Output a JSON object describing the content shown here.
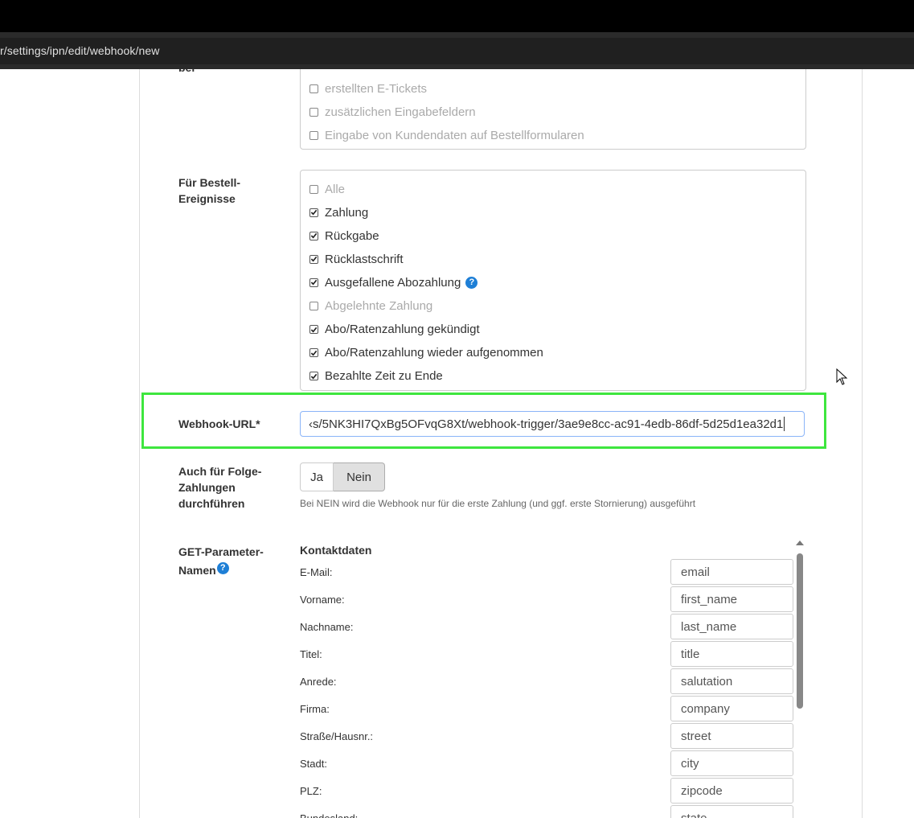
{
  "browser": {
    "url": "r/settings/ipn/edit/webhook/new"
  },
  "top_section": {
    "label_fragment": "bei",
    "items": [
      {
        "label": "erstellten E-Tickets",
        "checked": false,
        "disabled": true
      },
      {
        "label": "zusätzlichen Eingabefeldern",
        "checked": false,
        "disabled": true
      },
      {
        "label": "Eingabe von Kundendaten auf Bestellformularen",
        "checked": false,
        "disabled": true
      }
    ]
  },
  "order_events": {
    "label": "Für Bestell-Ereignisse",
    "label_line1": "Für Bestell-",
    "label_line2": "Ereignisse",
    "items": [
      {
        "label": "Alle",
        "checked": false,
        "disabled": true
      },
      {
        "label": "Zahlung",
        "checked": true,
        "disabled": false
      },
      {
        "label": "Rückgabe",
        "checked": true,
        "disabled": false
      },
      {
        "label": "Rücklastschrift",
        "checked": true,
        "disabled": false
      },
      {
        "label": "Ausgefallene Abozahlung",
        "checked": true,
        "disabled": false,
        "help": "?"
      },
      {
        "label": "Abgelehnte Zahlung",
        "checked": false,
        "disabled": true
      },
      {
        "label": "Abo/Ratenzahlung gekündigt",
        "checked": true,
        "disabled": false
      },
      {
        "label": "Abo/Ratenzahlung wieder aufgenommen",
        "checked": true,
        "disabled": false
      },
      {
        "label": "Bezahlte Zeit zu Ende",
        "checked": true,
        "disabled": false
      }
    ]
  },
  "webhook_url": {
    "label": "Webhook-URL*",
    "value": "‹s/5NK3HI7QxBg5OFvqG8Xt/webhook-trigger/3ae9e8cc-ac91-4edb-86df-5d25d1ea32d1"
  },
  "follow_up": {
    "label_line1": "Auch für Folge-",
    "label_line2": "Zahlungen",
    "label_line3": "durchführen",
    "option_yes": "Ja",
    "option_no": "Nein",
    "selected": "Nein",
    "hint": "Bei NEIN wird die Webhook nur für die erste Zahlung (und ggf. erste Stornierung) ausgeführt"
  },
  "get_params": {
    "label_line1": "GET-Parameter-",
    "label_line2": "Namen",
    "help": "?",
    "section_title": "Kontaktdaten",
    "rows": [
      {
        "label": "E-Mail:",
        "value": "email"
      },
      {
        "label": "Vorname:",
        "value": "first_name"
      },
      {
        "label": "Nachname:",
        "value": "last_name"
      },
      {
        "label": "Titel:",
        "value": "title"
      },
      {
        "label": "Anrede:",
        "value": "salutation"
      },
      {
        "label": "Firma:",
        "value": "company"
      },
      {
        "label": "Straße/Hausnr.:",
        "value": "street"
      },
      {
        "label": "Stadt:",
        "value": "city"
      },
      {
        "label": "PLZ:",
        "value": "zipcode"
      },
      {
        "label": "Bundesland:",
        "value": "state"
      }
    ]
  },
  "colors": {
    "highlight": "#3ee63e",
    "help_icon": "#1e7fd6"
  }
}
